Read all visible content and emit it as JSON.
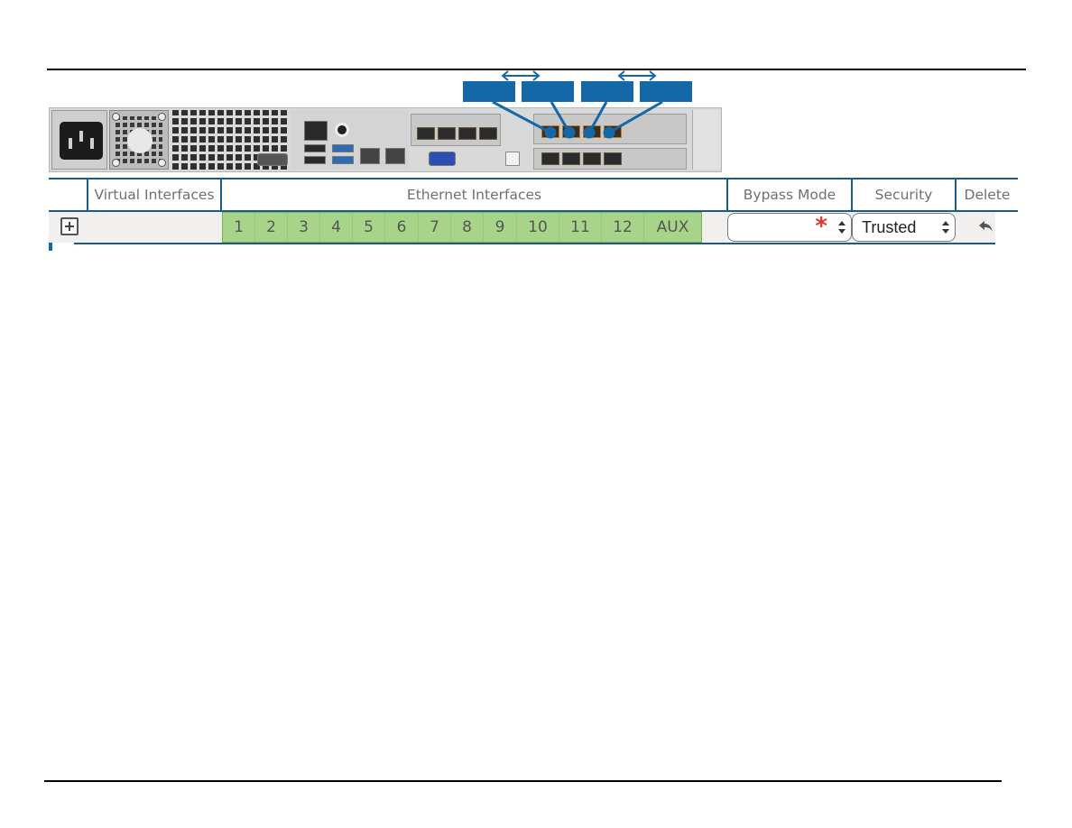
{
  "diagram": {
    "callouts": [
      {
        "id": "callout-1",
        "label": ""
      },
      {
        "id": "callout-2",
        "label": ""
      },
      {
        "id": "callout-3",
        "label": ""
      },
      {
        "id": "callout-4",
        "label": ""
      }
    ],
    "pair_arrows": [
      "bidirectional-arrow-pair-1",
      "bidirectional-arrow-pair-2"
    ],
    "colors": {
      "callout": "#1468a8",
      "header_border": "#1d5a84",
      "ethernet_selected": "#a8d48a",
      "required": "#e8322e"
    }
  },
  "table": {
    "headers": {
      "blank": "",
      "virtual_interfaces": "Virtual Interfaces",
      "ethernet_interfaces": "Ethernet Interfaces",
      "bypass_mode": "Bypass Mode",
      "security": "Security",
      "delete": "Delete"
    },
    "row": {
      "add_icon": "plus-square-icon",
      "virtual_interface": "",
      "ethernet_ports": [
        "1",
        "2",
        "3",
        "4",
        "5",
        "6",
        "7",
        "8",
        "9",
        "10",
        "11",
        "12",
        "AUX"
      ],
      "bypass_mode": {
        "value": "",
        "required_marker": "*"
      },
      "security": {
        "value": "Trusted"
      },
      "delete_icon": "undo-arrow-icon"
    }
  }
}
